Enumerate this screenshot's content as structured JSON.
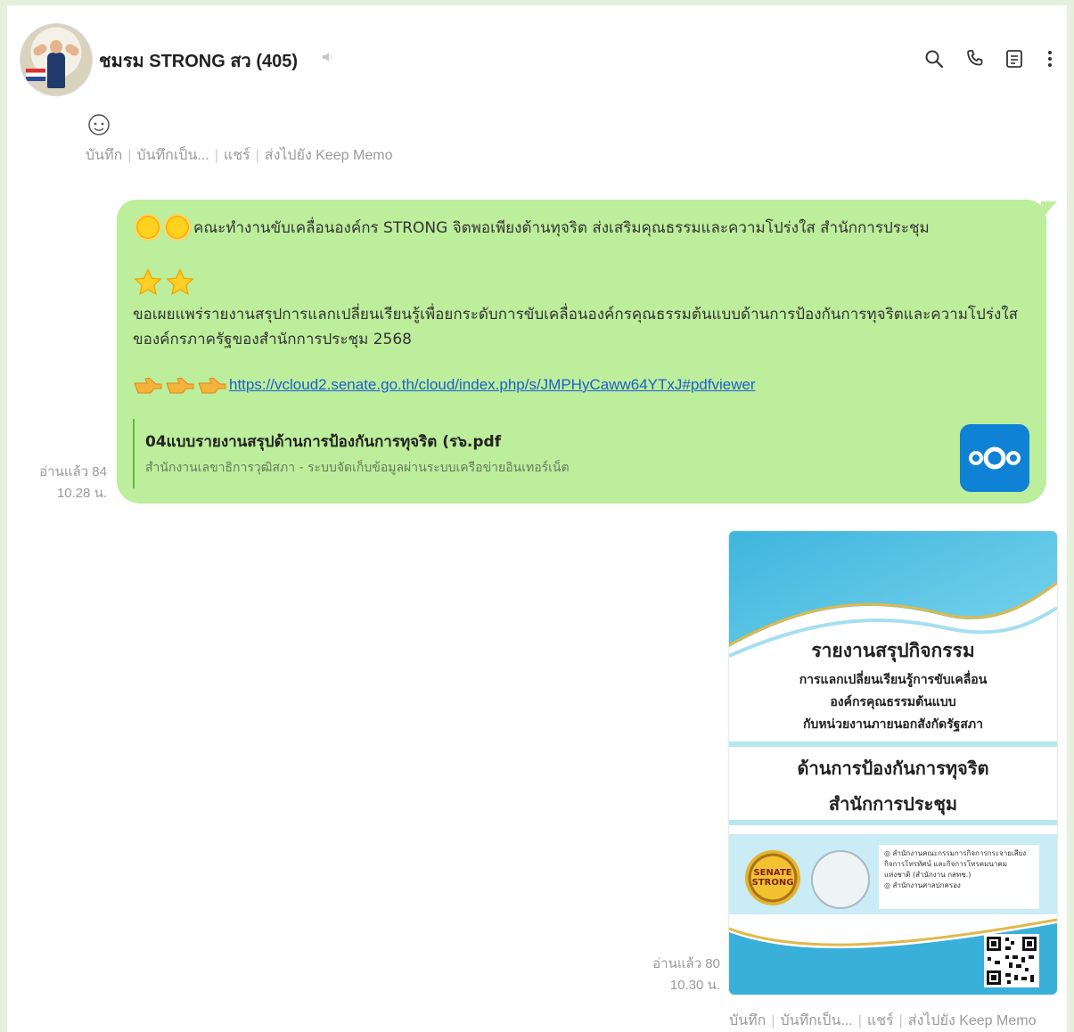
{
  "header": {
    "title": "ชมรม STRONG สว (405)",
    "icons": [
      "search-icon",
      "phone-icon",
      "notes-icon",
      "more-vert-icon"
    ]
  },
  "memo_actions_top": {
    "save": "บันทึก",
    "save_as": "บันทึกเป็น...",
    "share": "แชร์",
    "keep": "ส่งไปยัง Keep Memo"
  },
  "message1": {
    "line1": "คณะทำงานขับเคลื่อนองค์กร STRONG จิตพอเพียงต้านทุจริต ส่งเสริมคุณธรรมและความโปร่งใส สำนักการประชุม",
    "paragraph": "ขอเผยแพร่รายงานสรุปการแลกเปลี่ยนเรียนรู้เพื่อยกระดับการขับเคลื่อนองค์กรคุณธรรมต้นแบบด้านการป้องกันการทุจริตและความโปร่งใสของค์กรภาครัฐของสำนักการประชุม 2568",
    "link": "https://vcloud2.senate.go.th/cloud/index.php/s/JMPHyCaww64YTxJ#pdfviewer",
    "preview_title": "04แบบรายงานสรุปด้านการป้องกันการทุจริต (ร๖.pdf",
    "preview_source": "สำนักงานเลขาธิการวุฒิสภา - ระบบจัดเก็บข้อมูลผ่านระบบเครือข่ายอินเทอร์เน็ต",
    "read": "อ่านแล้ว 84",
    "time": "10.28 น."
  },
  "message2": {
    "read": "อ่านแล้ว 80",
    "time": "10.30 น.",
    "doc_title": "รายงานสรุปกิจกรรม",
    "doc_lines": [
      "การแลกเปลี่ยนเรียนรู้การขับเคลื่อน",
      "องค์กรคุณธรรมต้นแบบ",
      "กับหน่วยงานภายนอกสังกัดรัฐสภา"
    ],
    "doc_sub": [
      "ด้านการป้องกันการทุจริต",
      "สำนักการประชุม"
    ],
    "seal_text": "SENATE STRONG",
    "info_lines": [
      "◎ สำนักงานคณะกรรมการกิจการกระจายเสียง",
      "กิจการโทรทัศน์ และกิจการโทรคมนาคม",
      "แห่งชาติ (สำนักงาน กสทช.)",
      "◎ สำนักงานศาลปกครอง"
    ]
  },
  "memo_actions_bottom": {
    "save": "บันทึก",
    "save_as": "บันทึกเป็น...",
    "share": "แชร์",
    "keep": "ส่งไปยัง Keep Memo"
  },
  "colors": {
    "bubble": "#bdee9b",
    "link": "#1b5fd0",
    "nextcloud": "#0f82d6"
  }
}
